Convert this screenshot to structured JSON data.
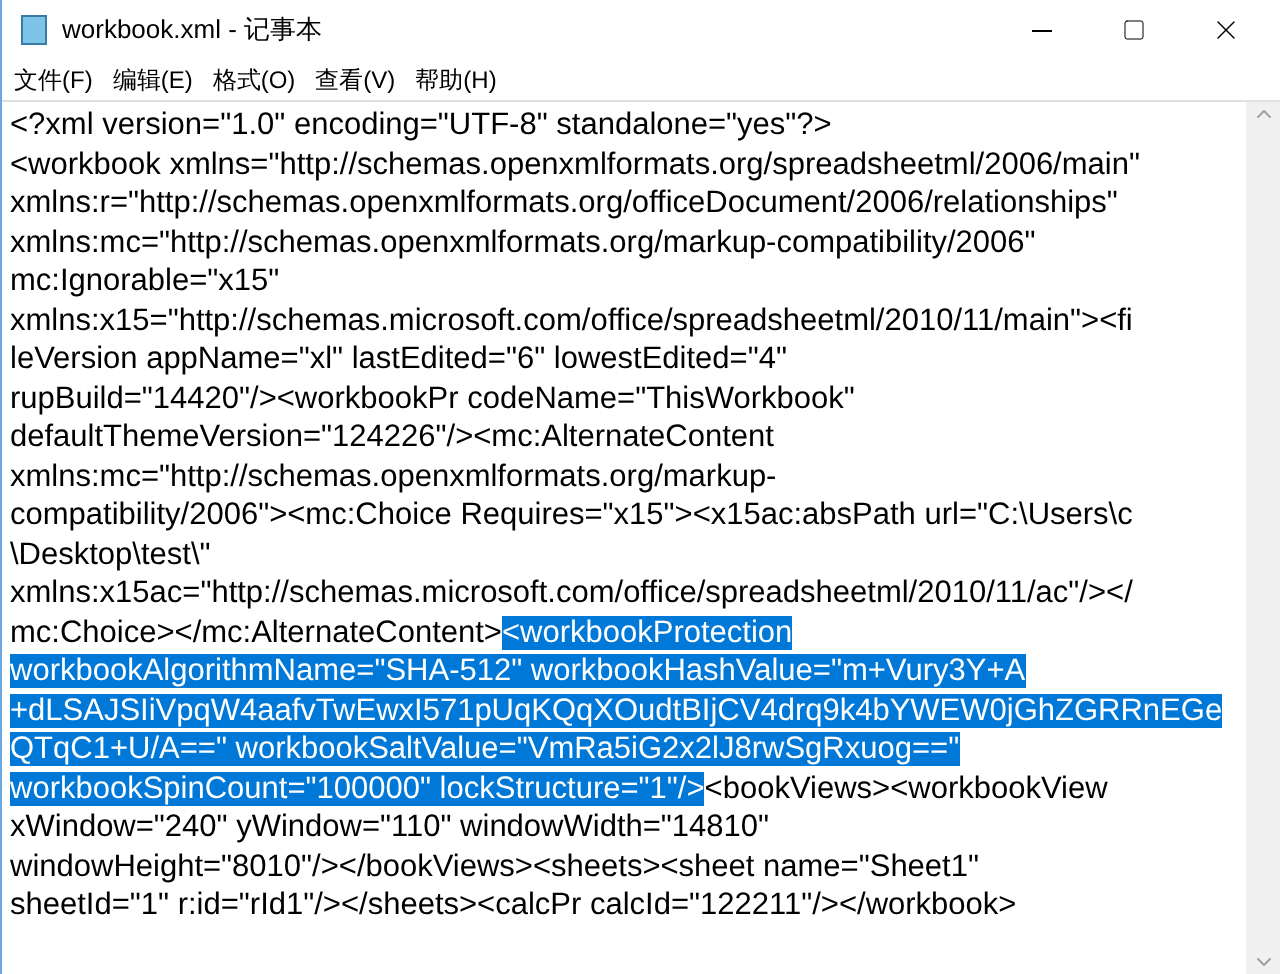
{
  "window": {
    "title": "workbook.xml - 记事本"
  },
  "menu": [
    {
      "label": "文件(F)"
    },
    {
      "label": "编辑(E)"
    },
    {
      "label": "格式(O)"
    },
    {
      "label": "查看(V)"
    },
    {
      "label": "帮助(H)"
    }
  ],
  "lines": [
    [
      {
        "text": "<?xml version=\"1.0\" encoding=\"UTF-8\" standalone=\"yes\"?>",
        "selected": false
      }
    ],
    [
      {
        "text": "<workbook xmlns=\"http://schemas.openxmlformats.org/spreadsheetml/2006/main\"",
        "selected": false
      }
    ],
    [
      {
        "text": "xmlns:r=\"http://schemas.openxmlformats.org/officeDocument/2006/relationships\"",
        "selected": false
      }
    ],
    [
      {
        "text": "xmlns:mc=\"http://schemas.openxmlformats.org/markup-compatibility/2006\"",
        "selected": false
      }
    ],
    [
      {
        "text": "mc:Ignorable=\"x15\"",
        "selected": false
      }
    ],
    [
      {
        "text": "xmlns:x15=\"http://schemas.microsoft.com/office/spreadsheetml/2010/11/main\"><fi",
        "selected": false
      }
    ],
    [
      {
        "text": "leVersion appName=\"xl\" lastEdited=\"6\" lowestEdited=\"4\"",
        "selected": false
      }
    ],
    [
      {
        "text": "rupBuild=\"14420\"/><workbookPr codeName=\"ThisWorkbook\"",
        "selected": false
      }
    ],
    [
      {
        "text": "defaultThemeVersion=\"124226\"/><mc:AlternateContent",
        "selected": false
      }
    ],
    [
      {
        "text": "xmlns:mc=\"http://schemas.openxmlformats.org/markup-",
        "selected": false
      }
    ],
    [
      {
        "text": "compatibility/2006\"><mc:Choice Requires=\"x15\"><x15ac:absPath url=\"C:\\Users\\c",
        "selected": false
      }
    ],
    [
      {
        "text": "\\Desktop\\test\\\"",
        "selected": false
      }
    ],
    [
      {
        "text": "xmlns:x15ac=\"http://schemas.microsoft.com/office/spreadsheetml/2010/11/ac\"/></",
        "selected": false
      }
    ],
    [
      {
        "text": "mc:Choice></mc:AlternateContent>",
        "selected": false
      },
      {
        "text": "<workbookProtection",
        "selected": true
      }
    ],
    [
      {
        "text": "workbookAlgorithmName=\"SHA-512\" workbookHashValue=\"m+Vury3Y+A",
        "selected": true
      }
    ],
    [
      {
        "text": "+dLSAJSIiVpqW4aafvTwEwxI571pUqKQqXOudtBIjCV4drq9k4bYWEW0jGhZGRRnEGe",
        "selected": true
      }
    ],
    [
      {
        "text": "QTqC1+U/A==\" workbookSaltValue=\"VmRa5iG2x2lJ8rwSgRxuog==\"",
        "selected": true
      }
    ],
    [
      {
        "text": "workbookSpinCount=\"100000\" lockStructure=\"1\"/>",
        "selected": true
      },
      {
        "text": "<bookViews><workbookView",
        "selected": false
      }
    ],
    [
      {
        "text": "xWindow=\"240\" yWindow=\"110\" windowWidth=\"14810\"",
        "selected": false
      }
    ],
    [
      {
        "text": "windowHeight=\"8010\"/></bookViews><sheets><sheet name=\"Sheet1\"",
        "selected": false
      }
    ],
    [
      {
        "text": "sheetId=\"1\" r:id=\"rId1\"/></sheets><calcPr calcId=\"122211\"/></workbook>",
        "selected": false
      }
    ]
  ]
}
